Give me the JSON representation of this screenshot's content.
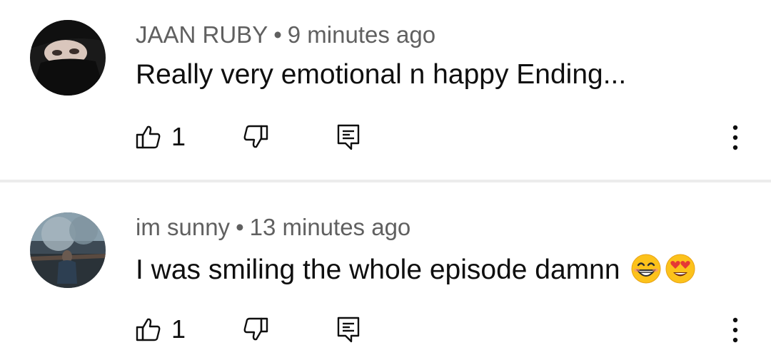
{
  "comments": [
    {
      "author": "JAAN RUBY",
      "separator": "•",
      "time": "9 minutes ago",
      "text": "Really very emotional n happy Ending...",
      "likes": "1",
      "emojis": []
    },
    {
      "author": "im sunny",
      "separator": "•",
      "time": "13 minutes ago",
      "text": "I was smiling the whole episode damnn",
      "likes": "1",
      "emojis": [
        "grinning-face-with-smiling-eyes",
        "heart-eyes-face"
      ]
    }
  ],
  "icons": {
    "like": "thumb-up-icon",
    "dislike": "thumb-down-icon",
    "reply": "reply-icon",
    "more": "more-vertical-icon"
  },
  "colors": {
    "background": "#ffffff",
    "text": "#0f0f0f",
    "meta": "#606060",
    "divider": "#ececec"
  }
}
